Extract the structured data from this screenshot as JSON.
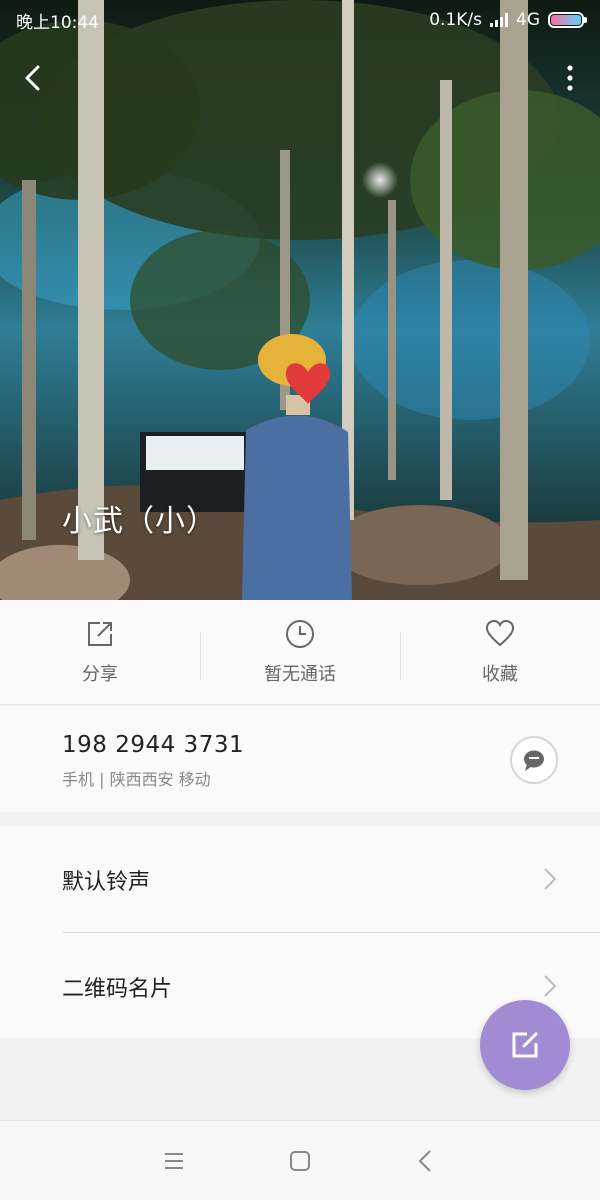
{
  "status_bar": {
    "time": "晚上10:44",
    "network_speed": "0.1K/s",
    "network_type": "4G"
  },
  "contact": {
    "name": "小武（小）"
  },
  "actions": [
    {
      "label": "分享",
      "icon": "share-icon"
    },
    {
      "label": "暂无通话",
      "icon": "clock-icon"
    },
    {
      "label": "收藏",
      "icon": "heart-icon"
    }
  ],
  "phone": {
    "number": "198 2944 3731",
    "meta": "手机  |  陕西西安 移动",
    "message_icon": "message-icon"
  },
  "settings": [
    {
      "label": "默认铃声"
    },
    {
      "label": "二维码名片"
    }
  ],
  "colors": {
    "accent": "#a28bd3",
    "page_bg": "#f2f2f2",
    "card_bg": "#fafafa"
  },
  "nav_icons": [
    "menu-icon",
    "home-icon",
    "back-icon"
  ]
}
